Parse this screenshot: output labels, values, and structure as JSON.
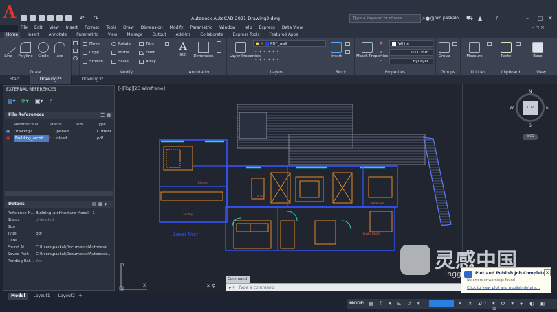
{
  "app": {
    "title": "Autodesk AutoCAD 2021   Drawing2.dwg",
    "search_placeholder": "Type a keyword or phrase",
    "user": "gjoko.paskalo...",
    "accent": "#e5302c"
  },
  "menu": [
    "File",
    "Edit",
    "View",
    "Insert",
    "Format",
    "Tools",
    "Draw",
    "Dimension",
    "Modify",
    "Parametric",
    "Window",
    "Help",
    "Express",
    "Data View"
  ],
  "ribbon_tabs": [
    "Home",
    "Insert",
    "Annotate",
    "Parametric",
    "View",
    "Manage",
    "Output",
    "Add-ins",
    "Collaborate",
    "Express Tools",
    "Featured Apps"
  ],
  "ribbon": {
    "draw": {
      "label": "Draw",
      "line": "Line",
      "polyline": "Polyline",
      "circle": "Circle",
      "arc": "Arc"
    },
    "modify": {
      "label": "Modify",
      "move": "Move",
      "rotate": "Rotate",
      "trim": "Trim",
      "copy": "Copy",
      "mirror": "Mirror",
      "fillet": "Fillet",
      "stretch": "Stretch",
      "scale": "Scale",
      "array": "Array"
    },
    "annotation": {
      "label": "Annotation",
      "text": "Text",
      "dimension": "Dimension"
    },
    "layers": {
      "label": "Layers",
      "properties": "Layer Properties",
      "current": "PDF_wall"
    },
    "block": {
      "label": "Block",
      "insert": "Insert"
    },
    "properties": {
      "label": "Properties",
      "match": "Match Properties",
      "color": "White",
      "lineweight": "0.00 mm",
      "linetype": "ByLayer"
    },
    "groups": {
      "label": "Groups",
      "group": "Group"
    },
    "utilities": {
      "label": "Utilities",
      "measure": "Measure"
    },
    "clipboard": {
      "label": "Clipboard",
      "paste": "Paste"
    },
    "view": {
      "label": "View",
      "base": "Base"
    }
  },
  "file_tabs": [
    "Start",
    "Drawing2*",
    "Drawing3*"
  ],
  "xref": {
    "title": "EXTERNAL REFERENCES",
    "file_refs_header": "File References",
    "columns": [
      "Reference N...",
      "Status",
      "Size",
      "Type"
    ],
    "rows": [
      {
        "name": "Drawing2",
        "status": "Opened",
        "size": "",
        "type": "Current"
      },
      {
        "name": "Building_archit...",
        "status": "Unload...",
        "size": "",
        "type": "pdf"
      }
    ],
    "details_header": "Details",
    "details": [
      {
        "k": "Reference N...",
        "v": "Building_architecture-Model - 1"
      },
      {
        "k": "Status",
        "v": "Unloaded"
      },
      {
        "k": "Size",
        "v": ""
      },
      {
        "k": "Type",
        "v": "pdf"
      },
      {
        "k": "Date",
        "v": ""
      },
      {
        "k": "Found At",
        "v": "C:\\Users\\paskal\\Documents\\Autodesk..."
      },
      {
        "k": "Saved Path",
        "v": "C:\\Users\\paskal\\Documents\\Autodesk..."
      },
      {
        "k": "Pending Ret...",
        "v": "Yes"
      }
    ]
  },
  "viewport": {
    "label": "[-][Top][2D Wireframe]",
    "cube": {
      "top": "TOP",
      "n": "N",
      "s": "S",
      "e": "E",
      "w": "W",
      "wcs": "WCS"
    },
    "plan_label": "Level First"
  },
  "command": {
    "title": "Command",
    "placeholder": "Type a command"
  },
  "layout_tabs": [
    "Model",
    "Layout1",
    "Layout2"
  ],
  "status": {
    "model": "MODEL",
    "scale": "1:1"
  },
  "toast": {
    "title": "Plot and Publish Job Complete",
    "line1": "No errors or warnings found",
    "link": "Click to view plot and publish details..."
  },
  "watermark": {
    "chinese": "灵感中国",
    "url": "lingganchina.com"
  }
}
